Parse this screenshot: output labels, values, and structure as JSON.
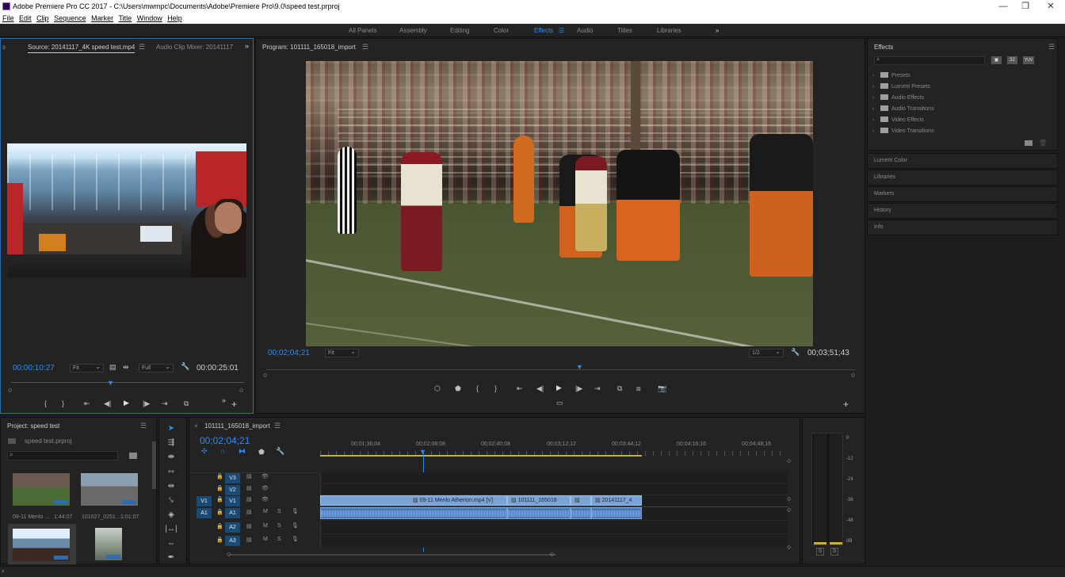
{
  "window": {
    "title": "Adobe Premiere Pro CC 2017 - C:\\Users\\mwmpc\\Documents\\Adobe\\Premiere Pro\\9.0\\speed test.prproj",
    "minimize": "—",
    "maximize": "❐",
    "close": "✕"
  },
  "menu": [
    "File",
    "Edit",
    "Clip",
    "Sequence",
    "Marker",
    "Title",
    "Window",
    "Help"
  ],
  "workspaces": {
    "items": [
      "All Panels",
      "Assembly",
      "Editing",
      "Color",
      "Effects",
      "Audio",
      "Titles",
      "Libraries"
    ],
    "active": "Effects",
    "more": "»"
  },
  "source": {
    "tab_source": "Source: 20141117_4K speed test.mp4",
    "tab_mixer": "Audio Clip Mixer: 20141117",
    "tab_s": "s",
    "timecode_in": "00:00:10:27",
    "fit": "Fit",
    "quality": "Full",
    "timecode_dur": "00:00:25:01"
  },
  "program": {
    "tab": "Program: 101111_165018_import",
    "timecode": "00;02;04;21",
    "fit": "Fit",
    "resolution": "1/2",
    "duration": "00;03;51;43"
  },
  "effects": {
    "title": "Effects",
    "search_placeholder": "",
    "items": [
      "Presets",
      "Lumetri Presets",
      "Audio Effects",
      "Audio Transitions",
      "Video Effects",
      "Video Transitions"
    ],
    "filter_badges": [
      "▣",
      "32",
      "YUV"
    ],
    "panels": [
      "Lumetri Color",
      "Libraries",
      "Markers",
      "History",
      "Info"
    ]
  },
  "project": {
    "title": "Project: speed test",
    "file": "speed test.prproj",
    "items": [
      {
        "name": "09-11 Menlo ...",
        "duration": "1:44:07"
      },
      {
        "name": "101027_0251...",
        "duration": "1:01:07"
      }
    ]
  },
  "timeline": {
    "tab": "101111_165018_import",
    "timecode": "00;02;04;21",
    "ruler_labels": [
      "00;01;36;04",
      "00;02;08;08",
      "00;02;40;08",
      "00;03;12;12",
      "00;03;44;12",
      "00;04;16;16",
      "00;04;48;16"
    ],
    "video_tracks": [
      "V3",
      "V2",
      "V1"
    ],
    "audio_tracks": [
      "A1",
      "A2",
      "A3"
    ],
    "source_v": "V1",
    "source_a": "A1",
    "clips": [
      "09-11 Menlo Atherton.mp4 [V]",
      "101111_165018",
      "20141117_4"
    ]
  },
  "meter": {
    "scale": [
      "0",
      "-12",
      "-24",
      "-36",
      "-48",
      "dB"
    ],
    "solo": [
      "S",
      "S"
    ]
  }
}
